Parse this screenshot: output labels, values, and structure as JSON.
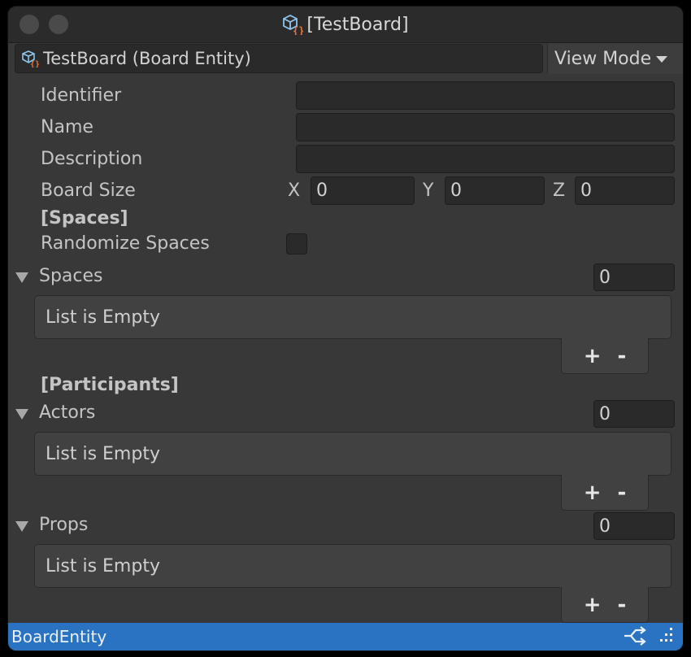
{
  "window": {
    "title": "[TestBoard]"
  },
  "header": {
    "object_label": "TestBoard (Board Entity)",
    "view_mode_label": "View Mode"
  },
  "fields": {
    "identifier": {
      "label": "Identifier",
      "value": ""
    },
    "name": {
      "label": "Name",
      "value": ""
    },
    "description": {
      "label": "Description",
      "value": ""
    },
    "board_size": {
      "label": "Board Size",
      "x_label": "X",
      "x": "0",
      "y_label": "Y",
      "y": "0",
      "z_label": "Z",
      "z": "0"
    }
  },
  "spaces_section": {
    "header": "[Spaces]",
    "randomize_label": "Randomize Spaces",
    "randomize_checked": false,
    "list": {
      "label": "Spaces",
      "count": "0",
      "empty_text": "List is Empty"
    }
  },
  "participants_section": {
    "header": "[Participants]",
    "actors": {
      "label": "Actors",
      "count": "0",
      "empty_text": "List is Empty"
    },
    "props": {
      "label": "Props",
      "count": "0",
      "empty_text": "List is Empty"
    }
  },
  "list_controls": {
    "add": "+",
    "remove": "-"
  },
  "statusbar": {
    "text": "BoardEntity"
  },
  "colors": {
    "accent": "#2a72c2",
    "panel": "#383838",
    "field": "#2a2a2a"
  }
}
